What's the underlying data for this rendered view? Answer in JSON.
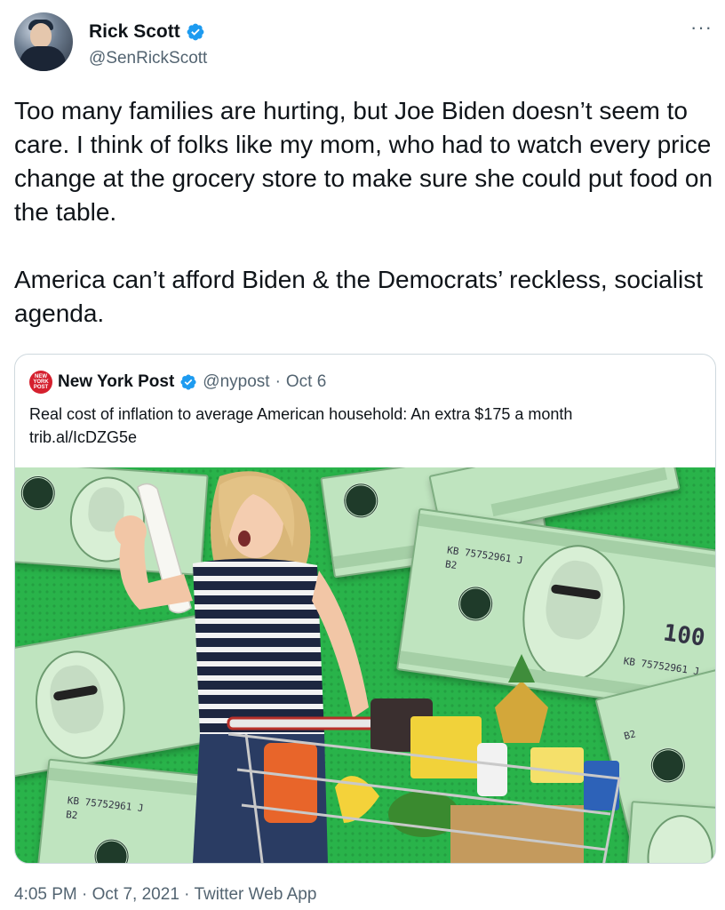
{
  "tweet": {
    "author_name": "Rick Scott",
    "author_handle": "@SenRickScott",
    "more_icon": "···",
    "text": "Too many families are hurting, but Joe Biden doesn’t seem to care. I think of folks like my mom, who had to watch every price change at the grocery store to make sure she could put food on the table.\n\nAmerica can’t afford Biden & the Democrats’ reckless, socialist agenda.",
    "time": "4:05 PM",
    "date": "Oct 7, 2021",
    "source": "Twitter Web App",
    "separator": "·"
  },
  "quote": {
    "logo_text": "NEW YORK POST",
    "author_name": "New York Post",
    "author_handle": "@nypost",
    "date": "Oct 6",
    "text": "Real cost of inflation to average American household: An extra $175 a month\ntrib.al/IcDZG5e",
    "bill_serial": "KB 75752961 J",
    "bill_code": "B2",
    "bill_denomination": "100"
  },
  "colors": {
    "verified": "#1d9bf0",
    "secondary_text": "#536471",
    "border": "#cfd9de",
    "image_background": "#29b34a"
  }
}
